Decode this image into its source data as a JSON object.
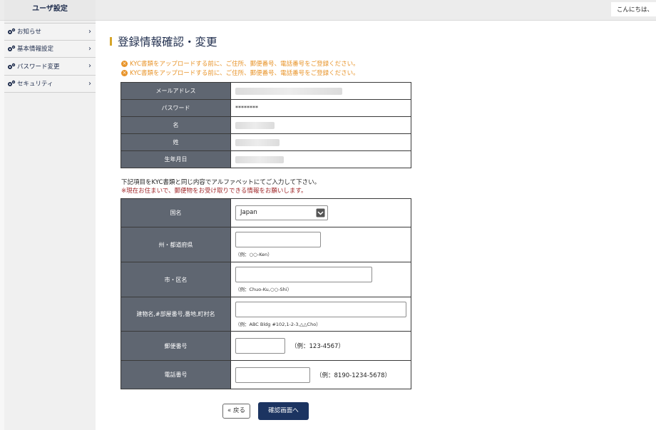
{
  "header": {
    "greeting": "こんにちは、"
  },
  "sidebar": {
    "title": "ユーザ設定",
    "items": [
      {
        "label": "お知らせ",
        "icon": "gears-icon"
      },
      {
        "label": "基本情報設定",
        "icon": "gears-icon"
      },
      {
        "label": "パスワード変更",
        "icon": "gears-icon"
      },
      {
        "label": "セキュリティ",
        "icon": "gears-icon"
      }
    ]
  },
  "main": {
    "title": "登録情報確認・変更",
    "warnings": [
      "KYC書類をアップロードする前に、ご住所、郵便番号、電話番号をご登録ください。",
      "KYC書類をアップロードする前に、ご住所、郵便番号、電話番号をご登録ください。"
    ],
    "account_table": {
      "rows": [
        {
          "label": "メールアドレス",
          "value": ""
        },
        {
          "label": "パスワード",
          "value": "********"
        },
        {
          "label": "名",
          "value": ""
        },
        {
          "label": "姓",
          "value": ""
        },
        {
          "label": "生年月日",
          "value": ""
        }
      ]
    },
    "instruction": "下記項目をKYC書類と同じ内容でアルファベットにてご入力して下さい。",
    "instruction_note": "※現在お住まいで、郵便物をお受け取りできる情報をお願いします。",
    "address_form": {
      "country": {
        "label": "国名",
        "selected": "Japan"
      },
      "state": {
        "label": "州・都道府県",
        "value": "",
        "example": "（例：○○-Ken）"
      },
      "city": {
        "label": "市・区名",
        "value": "",
        "example": "（例：Chuo-Ku,○○-Shi）"
      },
      "building": {
        "label": "建物名,#部屋番号,番地,町村名",
        "value": "",
        "example": "（例：ABC Bldg #102,1-2-3,△△Cho）"
      },
      "postal": {
        "label": "郵便番号",
        "value": "",
        "example": "（例：123-4567）"
      },
      "phone": {
        "label": "電話番号",
        "value": "",
        "example": "（例：8190-1234-5678）"
      }
    },
    "buttons": {
      "back": "« 戻る",
      "confirm": "確認画面へ"
    }
  },
  "colors": {
    "accent": "#d6a52a",
    "navy": "#1c3461",
    "warning": "#e8942a",
    "label_bg": "#5f6671",
    "alert_red": "#a0282a"
  }
}
